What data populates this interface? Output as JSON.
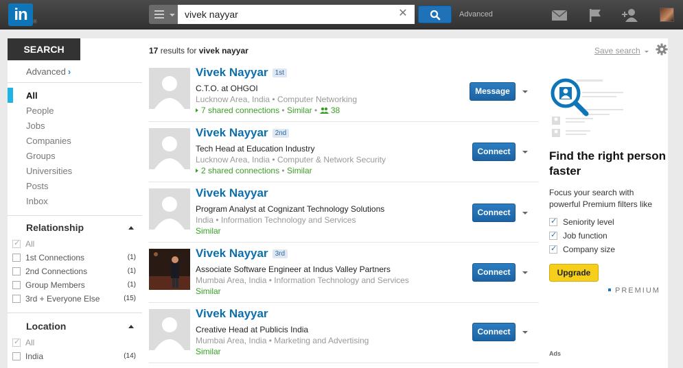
{
  "topbar": {
    "logo_text": "in",
    "logo_mark": "®",
    "search_value": "vivek nayyar",
    "advanced_label": "Advanced",
    "icons": [
      "menu-icon",
      "clear-icon",
      "search-icon",
      "messages-icon",
      "flag-icon",
      "add-connections-icon",
      "profile-avatar"
    ]
  },
  "sidebar": {
    "header": "SEARCH",
    "advanced_label": "Advanced",
    "filters": [
      "All",
      "People",
      "Jobs",
      "Companies",
      "Groups",
      "Universities",
      "Posts",
      "Inbox"
    ],
    "active_filter": "All",
    "relationship": {
      "title": "Relationship",
      "options": [
        {
          "label": "All",
          "count": "",
          "checked": true
        },
        {
          "label": "1st Connections",
          "count": "(1)",
          "checked": false
        },
        {
          "label": "2nd Connections",
          "count": "(1)",
          "checked": false
        },
        {
          "label": "Group Members",
          "count": "(1)",
          "checked": false
        },
        {
          "label": "3rd + Everyone Else",
          "count": "(15)",
          "checked": false
        }
      ]
    },
    "location": {
      "title": "Location",
      "options": [
        {
          "label": "All",
          "count": "",
          "checked": true
        },
        {
          "label": "India",
          "count": "(14)",
          "checked": false
        }
      ]
    }
  },
  "main": {
    "results_count": "17",
    "results_text": "results for",
    "results_query": "vivek nayyar",
    "results": [
      {
        "name": "Vivek Nayyar",
        "degree": "1st",
        "headline": "C.T.O. at OHGOI",
        "location": "Lucknow Area, India",
        "industry": "Computer Networking",
        "shared": "7 shared connections",
        "similar": "Similar",
        "group_count": "38",
        "action": "Message",
        "photo": "placeholder"
      },
      {
        "name": "Vivek Nayyar",
        "degree": "2nd",
        "headline": "Tech Head at Education Industry",
        "location": "Lucknow Area, India",
        "industry": "Computer & Network Security",
        "shared": "2 shared connections",
        "similar": "Similar",
        "action": "Connect",
        "photo": "placeholder"
      },
      {
        "name": "Vivek Nayyar",
        "degree": "",
        "headline": "Program Analyst at Cognizant Technology Solutions",
        "location": "India",
        "industry": "Information Technology and Services",
        "similar": "Similar",
        "action": "Connect",
        "photo": "placeholder"
      },
      {
        "name": "Vivek Nayyar",
        "degree": "3rd",
        "headline": "Associate Software Engineer at Indus Valley Partners",
        "location": "Mumbai Area, India",
        "industry": "Information Technology and Services",
        "similar": "Similar",
        "action": "Connect",
        "photo": "portrait"
      },
      {
        "name": "Vivek Nayyar",
        "degree": "",
        "headline": "Creative Head at Publicis India",
        "location": "Mumbai Area, India",
        "industry": "Marketing and Advertising",
        "similar": "Similar",
        "action": "Connect",
        "photo": "placeholder"
      }
    ]
  },
  "rightcol": {
    "save_search": "Save search",
    "promo_title": "Find the right person faster",
    "promo_sub": "Focus your search with powerful Premium filters like",
    "features": [
      "Seniority level",
      "Job function",
      "Company size"
    ],
    "upgrade_label": "Upgrade",
    "premium_label": "PREMIUM",
    "ads_label": "Ads"
  },
  "colors": {
    "brand_blue": "#0e76b8",
    "link_blue": "#0b6fae",
    "green": "#3a9f24",
    "upgrade_yellow": "#f5cf1a",
    "active_filter_bar": "#1fb4e6"
  }
}
